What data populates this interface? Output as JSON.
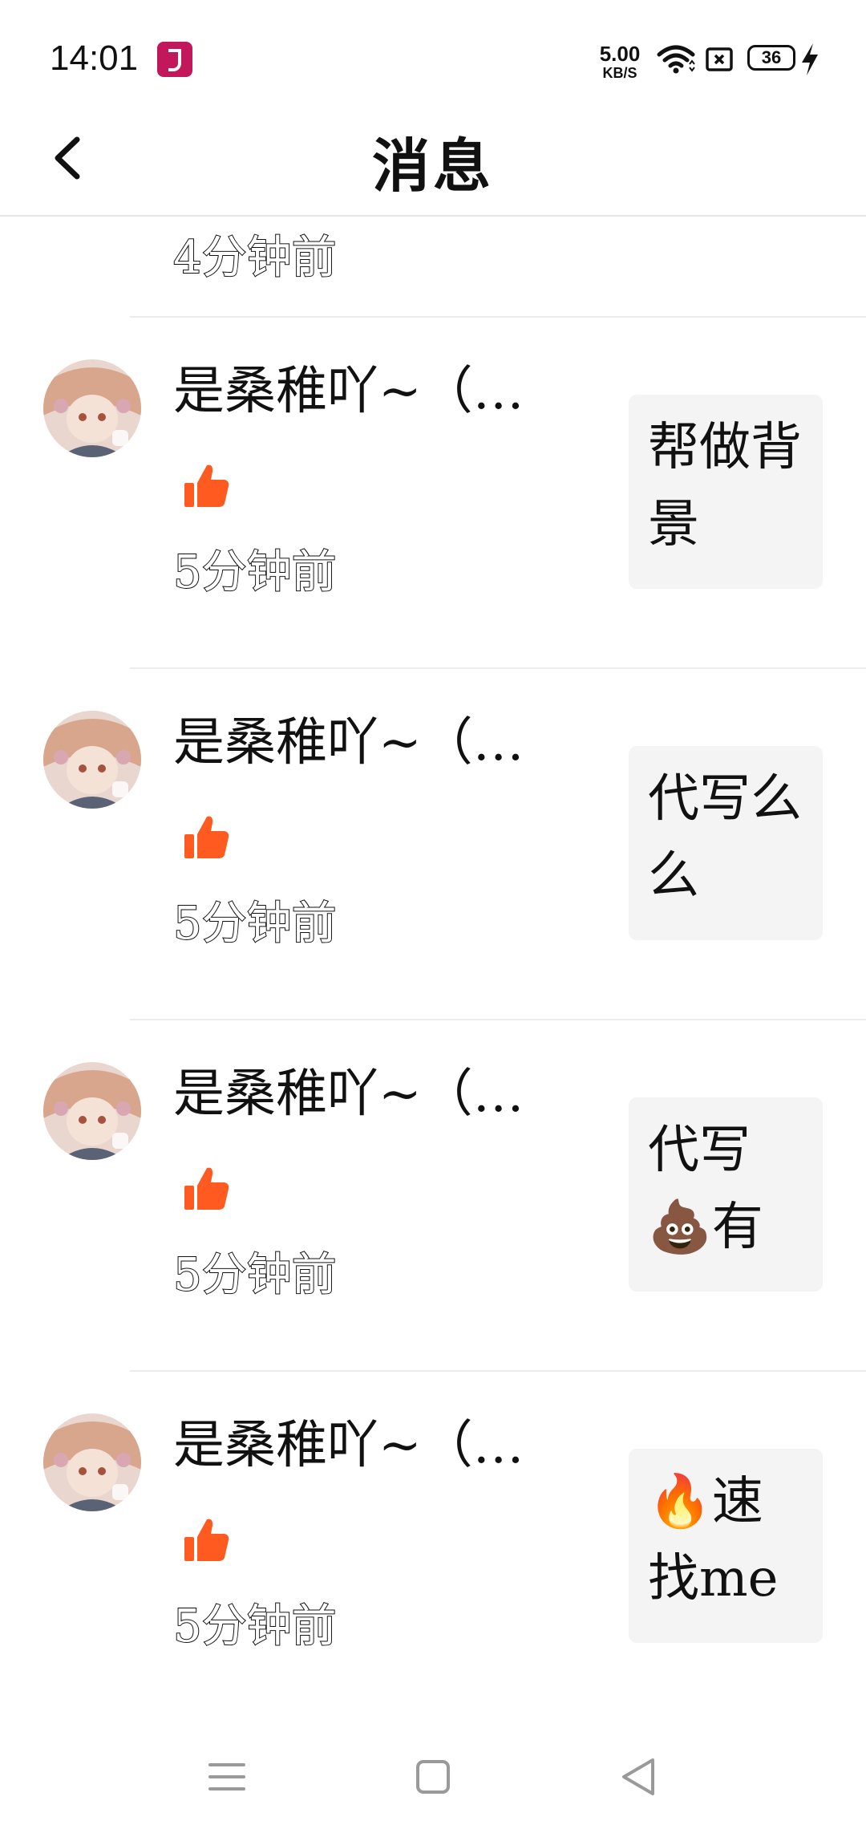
{
  "status_bar": {
    "time": "14:01",
    "net_speed_value": "5.00",
    "net_speed_unit": "KB/S",
    "battery_level": "36",
    "icons": [
      "tiktok-app-icon",
      "wifi-icon",
      "sim-icon",
      "battery-icon",
      "charging-icon"
    ]
  },
  "header": {
    "title": "消息",
    "back_icon": "chevron-left-icon"
  },
  "partial_item": {
    "time": "4分钟前"
  },
  "items": [
    {
      "username": "是桑稚吖~（…",
      "time": "5分钟前",
      "comment": "帮做背景",
      "action_icon": "thumbs-up-icon"
    },
    {
      "username": "是桑稚吖~（…",
      "time": "5分钟前",
      "comment": "代写么么",
      "action_icon": "thumbs-up-icon"
    },
    {
      "username": "是桑稚吖~（…",
      "time": "5分钟前",
      "comment": "代写💩有",
      "action_icon": "thumbs-up-icon"
    },
    {
      "username": "是桑稚吖~（…",
      "time": "5分钟前",
      "comment": "🔥速找me",
      "action_icon": "thumbs-up-icon"
    }
  ],
  "colors": {
    "like": "#ff5a1f",
    "divider": "#ececec",
    "card_bg": "#f4f4f4"
  },
  "nav_bar": {
    "icons": [
      "menu-icon",
      "home-square-icon",
      "back-triangle-icon"
    ]
  }
}
